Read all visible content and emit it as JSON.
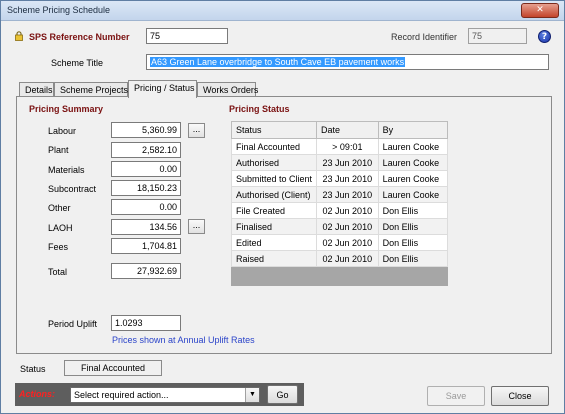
{
  "window": {
    "title": "Scheme Pricing Schedule",
    "close": "✕"
  },
  "header": {
    "sps_label": "SPS Reference Number",
    "sps_value": "75",
    "record_label": "Record Identifier",
    "record_value": "75",
    "help_glyph": "?",
    "scheme_title_label": "Scheme Title",
    "scheme_title_value": "A63 Green Lane overbridge to South  Cave EB pavement works"
  },
  "tabs": [
    {
      "label": "Details"
    },
    {
      "label": "Scheme Projects"
    },
    {
      "label": "Pricing / Status"
    },
    {
      "label": "Works Orders"
    }
  ],
  "pricing_summary": {
    "heading": "Pricing Summary",
    "rows": [
      {
        "label": "Labour",
        "value": "5,360.99"
      },
      {
        "label": "Plant",
        "value": "2,582.10"
      },
      {
        "label": "Materials",
        "value": "0.00"
      },
      {
        "label": "Subcontract",
        "value": "18,150.23"
      },
      {
        "label": "Other",
        "value": "0.00"
      },
      {
        "label": "LAOH",
        "value": "134.56"
      },
      {
        "label": "Fees",
        "value": "1,704.81"
      }
    ],
    "total_label": "Total",
    "total_value": "27,932.69",
    "ellipsis": "...",
    "uplift_label": "Period Uplift",
    "uplift_value": "1.0293",
    "uplift_note": "Prices shown at Annual Uplift Rates"
  },
  "pricing_status": {
    "heading": "Pricing Status",
    "columns": [
      "Status",
      "Date",
      "By"
    ],
    "rows": [
      {
        "status": "Final Accounted",
        "date": "> 09:01",
        "by": "Lauren Cooke"
      },
      {
        "status": "Authorised",
        "date": "23 Jun 2010",
        "by": "Lauren Cooke"
      },
      {
        "status": "Submitted to Client",
        "date": "23 Jun 2010",
        "by": "Lauren Cooke"
      },
      {
        "status": "Authorised (Client)",
        "date": "23 Jun 2010",
        "by": "Lauren Cooke"
      },
      {
        "status": "File Created",
        "date": "02 Jun 2010",
        "by": "Don Ellis"
      },
      {
        "status": "Finalised",
        "date": "02 Jun 2010",
        "by": "Don Ellis"
      },
      {
        "status": "Edited",
        "date": "02 Jun 2010",
        "by": "Don Ellis"
      },
      {
        "status": "Raised",
        "date": "02 Jun 2010",
        "by": "Don Ellis"
      }
    ]
  },
  "footer": {
    "status_label": "Status",
    "status_value": "Final Accounted",
    "actions_label": "Actions:",
    "actions_select": "Select required action...",
    "go_label": "Go",
    "save_label": "Save",
    "close_label": "Close"
  }
}
